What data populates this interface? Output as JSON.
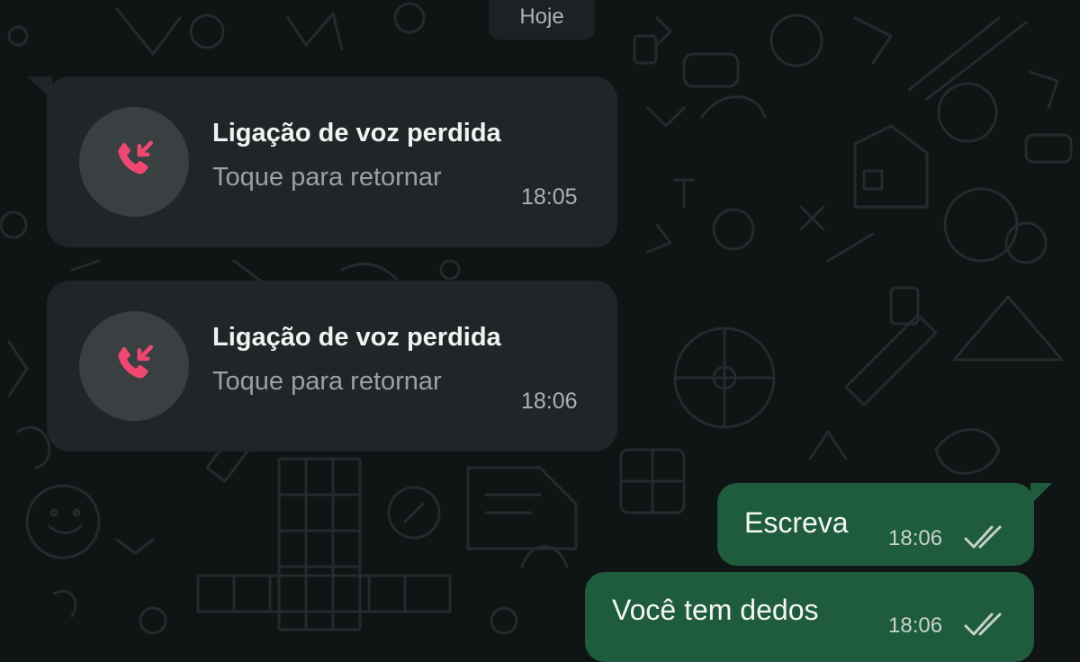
{
  "date_chip": "Hoje",
  "missed_calls": [
    {
      "title": "Ligação de voz perdida",
      "subtitle": "Toque para retornar",
      "time": "18:05"
    },
    {
      "title": "Ligação de voz perdida",
      "subtitle": "Toque para retornar",
      "time": "18:06"
    }
  ],
  "outgoing_messages": [
    {
      "text": "Escreva",
      "time": "18:06",
      "status_icon": "double-check-icon"
    },
    {
      "text": "Você tem dedos",
      "time": "18:06",
      "status_icon": "double-check-icon"
    }
  ],
  "colors": {
    "background": "#0f1415",
    "incoming_bubble": "#202628",
    "outgoing_bubble": "#1f5c3d",
    "missed_call_icon": "#ef4870"
  }
}
